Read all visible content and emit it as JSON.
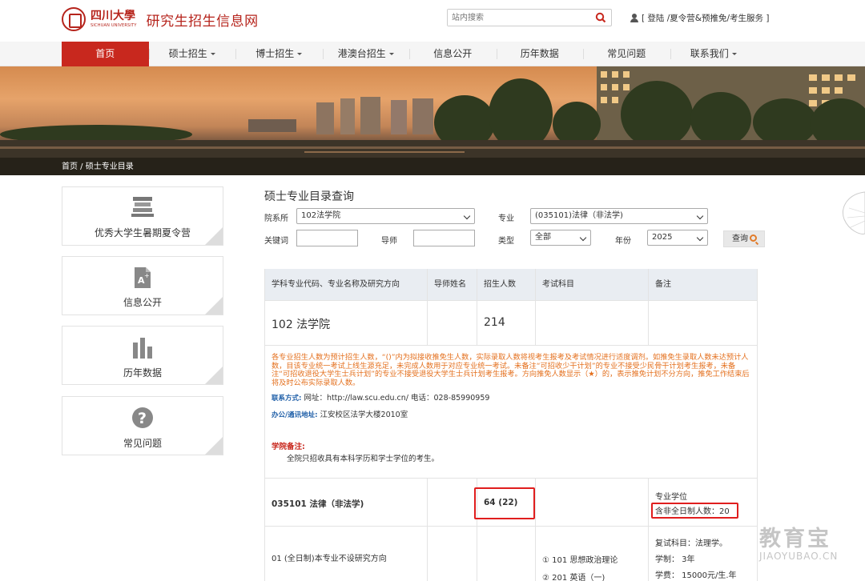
{
  "header": {
    "logo_cn": "四川大學",
    "logo_en": "SICHUAN UNIVERSITY",
    "site_title": "研究生招生信息网",
    "search_placeholder": "站内搜索",
    "user_links": "[ 登陆 /夏令营&预推免/考生服务 ]"
  },
  "nav": {
    "items": [
      {
        "label": "首页"
      },
      {
        "label": "硕士招生"
      },
      {
        "label": "博士招生"
      },
      {
        "label": "港澳台招生"
      },
      {
        "label": "信息公开"
      },
      {
        "label": "历年数据"
      },
      {
        "label": "常见问题"
      },
      {
        "label": "联系我们"
      }
    ]
  },
  "breadcrumb": "首页 / 硕士专业目录",
  "sidebar": {
    "items": [
      {
        "label": "优秀大学生暑期夏令营",
        "icon": "books-icon"
      },
      {
        "label": "信息公开",
        "icon": "document-icon"
      },
      {
        "label": "历年数据",
        "icon": "bar-chart-icon"
      },
      {
        "label": "常见问题",
        "icon": "question-icon"
      }
    ]
  },
  "main": {
    "title": "硕士专业目录查询",
    "filters": {
      "department_label": "院系所",
      "department_value": "102法学院",
      "major_label": "专业",
      "major_value": "(035101)法律（非法学)",
      "keyword_label": "关键词",
      "advisor_label": "导师",
      "type_label": "类型",
      "type_value": "全部",
      "year_label": "年份",
      "year_value": "2025",
      "query_label": "查询"
    },
    "table": {
      "headers": [
        "学科专业代码、专业名称及研究方向",
        "导师姓名",
        "招生人数",
        "考试科目",
        "备注"
      ],
      "college_name": "102 法学院",
      "college_count": "214",
      "notice": "各专业招生人数为预计招生人数，“()”内为拟接收推免生人数，实际录取人数将视考生报考及考试情况进行适度调剂。如推免生录取人数未达预计人数，目该专业统一考试上线生源充足，未完成人数用于对应专业统一考试。未备注“可招收少干计划”的专业不接受少民骨干计划考生报考，未备注“可招收退役大学生士兵计划”的专业不接受退役大学生士兵计划考生报考。方向推免人数显示（★）的，表示推免计划不分方向，推免工作结束后将及时公布实际录取人数。",
      "contact_label": "联系方式:",
      "contact_text": "网址：http://law.scu.edu.cn/ 电话：028-85990959",
      "address_label": "办公/通讯地址:",
      "address_text": "江安校区法学大楼2010室",
      "remark_title": "学院备注:",
      "remark_text": "全院只招收具有本科学历和学士学位的考生。",
      "major_row": {
        "name": "035101 法律（非法学)",
        "count": "64 (22)",
        "degree": "专业学位",
        "part_time": "含非全日制人数：20"
      },
      "direction_row": {
        "name": "01 (全日制)本专业不设研究方向",
        "exam_1": "① 101 思想政治理论",
        "exam_2": "② 201 英语（一)",
        "retest": "复试科目：法理学。",
        "duration": "学制：  3年",
        "fee": "学费：  15000元/生.年"
      }
    }
  },
  "watermark": {
    "cn": "教育宝",
    "en": "JIAOYUBAO.CN"
  }
}
